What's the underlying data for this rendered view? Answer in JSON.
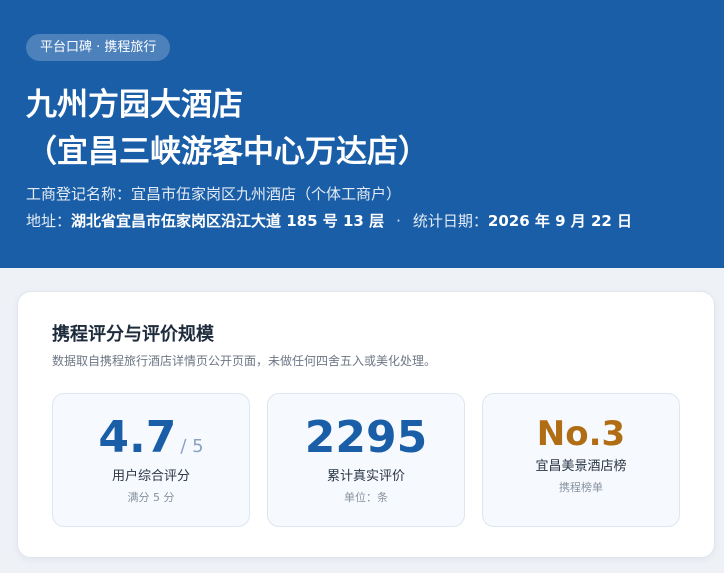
{
  "header": {
    "badge": "平台口碑 · 携程旅行",
    "title_line1": "九州方园大酒店",
    "title_line2": "（宜昌三峡游客中心万达店）",
    "reg_label": "工商登记名称：",
    "reg_value": "宜昌市伍家岗区九州酒店（个体工商户）",
    "address_label": "地址：",
    "address_value": "湖北省宜昌市伍家岗区沿江大道 185 号 13 层",
    "separator": "·",
    "date_label": "统计日期：",
    "date_value": "2026 年 9 月 22 日"
  },
  "ratings": {
    "title": "携程评分与评价规模",
    "subtitle": "数据取自携程旅行酒店详情页公开页面，未做任何四舍五入或美化处理。",
    "stats": [
      {
        "value": "4.7",
        "suffix": "/ 5",
        "label": "用户综合评分",
        "note": "满分 5 分"
      },
      {
        "value": "2295",
        "label": "累计真实评价",
        "note": "单位：条"
      },
      {
        "value": "No.3",
        "label": "宜昌美景酒店榜",
        "note": "携程榜单"
      }
    ]
  },
  "colors": {
    "header_bg": "#1a5ea8",
    "stat_value": "#1a5ea8",
    "rank_value": "#b06d14"
  }
}
